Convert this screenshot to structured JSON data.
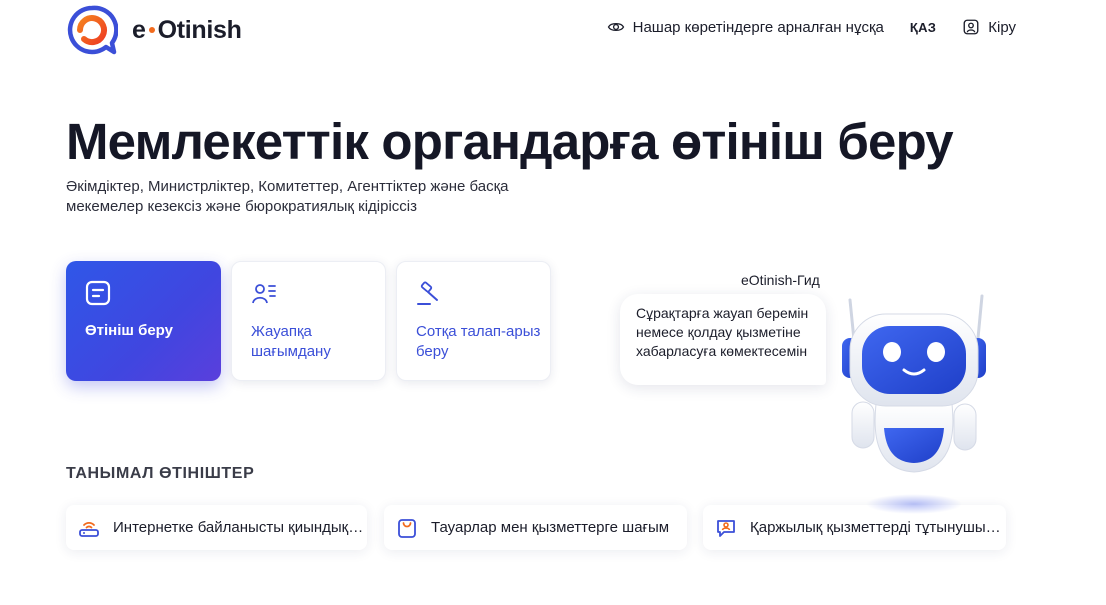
{
  "header": {
    "logo_text_left": "e",
    "logo_text_right": "Otinish",
    "low_vision_label": "Нашар көретіндерге арналған нұсқа",
    "language_label": "ҚАЗ",
    "login_label": "Кіру"
  },
  "hero": {
    "title": "Мемлекеттік органдарға өтініш беру",
    "subtitle": "Әкімдіктер, Министрліктер, Комитеттер, Агенттіктер және басқа мекемелер кезексіз және бюрократиялық кідіріссіз"
  },
  "actions": [
    {
      "label": "Өтініш беру",
      "icon": "document-list-icon"
    },
    {
      "label": "Жауапқа шағымдану",
      "icon": "user-list-icon"
    },
    {
      "label": "Сотқа талап-арыз беру",
      "icon": "gavel-icon"
    }
  ],
  "popular": {
    "title": "ТАНЫМАЛ ӨТІНІШТЕР",
    "items": [
      {
        "label": "Интернетке байланысты қиындықтар",
        "icon": "router-icon"
      },
      {
        "label": "Тауарлар мен қызметтерге шағым",
        "icon": "shopping-bag-icon"
      },
      {
        "label": "Қаржылық қызметтерді тұтынушылар",
        "icon": "customer-support-icon"
      }
    ]
  },
  "assistant": {
    "name": "eOtinish-Гид",
    "message": "Сұрақтарға жауап беремін немесе қолдау қызметіне хабарласуға көмектесемін"
  },
  "colors": {
    "brand_orange": "#f26b1d",
    "brand_blue": "#3b4fd8",
    "primary_gradient_start": "#2f57e8",
    "primary_gradient_end": "#5a3fdc"
  }
}
